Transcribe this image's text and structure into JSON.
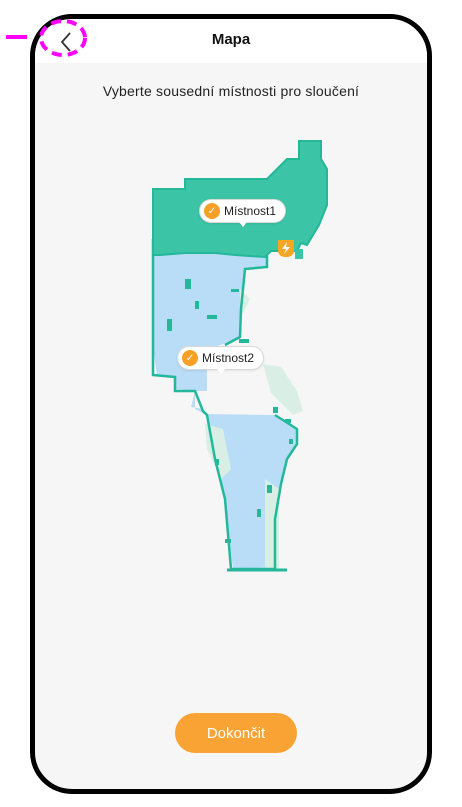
{
  "header": {
    "title": "Mapa"
  },
  "instruction": "Vyberte sousední místnosti pro sloučení",
  "rooms": [
    {
      "label": "Místnost1",
      "selected": true
    },
    {
      "label": "Místnost2",
      "selected": true
    }
  ],
  "footer": {
    "finish_label": "Dokončit"
  },
  "icons": {
    "back": "chevron-left-icon",
    "check": "check-icon",
    "dock": "charging-dock-icon"
  },
  "colors": {
    "accent_orange": "#f9a335",
    "room1_fill": "#3cc4a6",
    "room2_fill": "#b9dcf7",
    "border_teal": "#22b899",
    "highlight_annotation": "#ff00ff"
  }
}
